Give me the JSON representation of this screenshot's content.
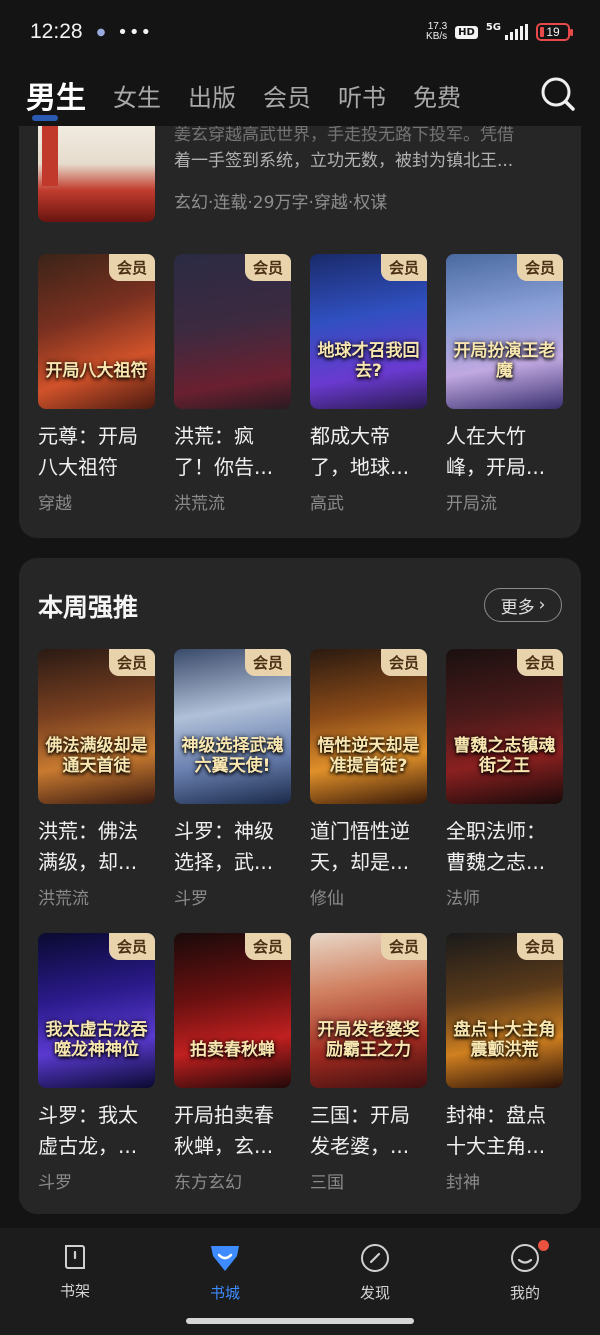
{
  "status_bar": {
    "time": "12:28",
    "network_speed_value": "17.3",
    "network_speed_unit": "KB/s",
    "hd": "HD",
    "signal": "5G",
    "battery": "19"
  },
  "top_nav": {
    "tabs": [
      "男生",
      "女生",
      "出版",
      "会员",
      "听书",
      "免费"
    ],
    "active_index": 0,
    "search_icon": "search-icon"
  },
  "featured": {
    "desc_line1": "姜玄穿越高武世界，手走投无路下投军。凭借",
    "desc_line2": "着一手签到系统，立功无数，被封为镇北王...",
    "meta": "玄幻·连载·29万字·穿越·权谋"
  },
  "row1": [
    {
      "title": "元尊：开局八大祖符",
      "genre": "穿越",
      "cover_text": "开局八大祖符",
      "vip": "会员"
    },
    {
      "title": "洪荒：疯了！你告...",
      "genre": "洪荒流",
      "cover_text": "",
      "vip": "会员"
    },
    {
      "title": "都成大帝了，地球...",
      "genre": "高武",
      "cover_text": "地球才召我回去?",
      "vip": "会员"
    },
    {
      "title": "人在大竹峰，开局...",
      "genre": "开局流",
      "cover_text": "开局扮演王老魔",
      "vip": "会员"
    }
  ],
  "weekly": {
    "heading": "本周强推",
    "more_label": "更多",
    "row1": [
      {
        "title": "洪荒：佛法满级，却...",
        "genre": "洪荒流",
        "cover_text": "佛法满级却是通天首徒",
        "vip": "会员"
      },
      {
        "title": "斗罗：神级选择，武...",
        "genre": "斗罗",
        "cover_text": "神级选择武魂六翼天使!",
        "vip": "会员"
      },
      {
        "title": "道门悟性逆天，却是...",
        "genre": "修仙",
        "cover_text": "悟性逆天却是准提首徒?",
        "vip": "会员"
      },
      {
        "title": "全职法师：曹魏之志...",
        "genre": "法师",
        "cover_text": "曹魏之志镇魂街之王",
        "vip": "会员"
      }
    ],
    "row2": [
      {
        "title": "斗罗：我太虚古龙，...",
        "genre": "斗罗",
        "cover_text": "我太虚古龙吞噬龙神神位",
        "vip": "会员"
      },
      {
        "title": "开局拍卖春秋蝉，玄...",
        "genre": "东方玄幻",
        "cover_text": "拍卖春秋蝉",
        "vip": "会员"
      },
      {
        "title": "三国：开局发老婆，...",
        "genre": "三国",
        "cover_text": "开局发老婆奖励霸王之力",
        "vip": "会员"
      },
      {
        "title": "封神：盘点十大主角...",
        "genre": "封神",
        "cover_text": "盘点十大主角震颤洪荒",
        "vip": "会员"
      }
    ]
  },
  "bottom_nav": [
    {
      "label": "书架",
      "icon": "bookshelf-icon"
    },
    {
      "label": "书城",
      "icon": "bookstore-icon"
    },
    {
      "label": "发现",
      "icon": "discover-icon"
    },
    {
      "label": "我的",
      "icon": "profile-icon"
    }
  ],
  "colors": {
    "accent": "#3d8bff",
    "vip_badge": "#e9d3ad",
    "card_bg": "#262626"
  }
}
